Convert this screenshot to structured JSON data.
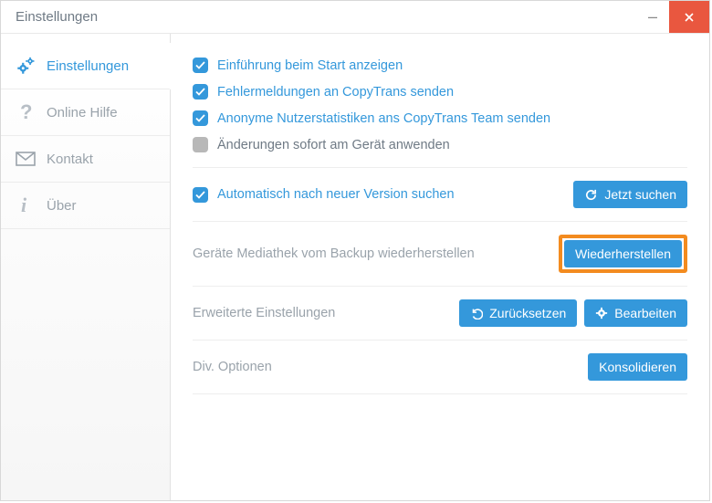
{
  "window": {
    "title": "Einstellungen"
  },
  "sidebar": {
    "items": [
      {
        "label": "Einstellungen"
      },
      {
        "label": "Online Hilfe"
      },
      {
        "label": "Kontakt"
      },
      {
        "label": "Über"
      }
    ]
  },
  "checks": {
    "c0": "Einführung beim Start anzeigen",
    "c1": "Fehlermeldungen an CopyTrans senden",
    "c2": "Anonyme Nutzerstatistiken ans CopyTrans Team senden",
    "c3": "Änderungen sofort am Gerät anwenden"
  },
  "rows": {
    "auto_check_label": "Automatisch nach neuer Version suchen",
    "search_btn": "Jetzt suchen",
    "restore_label": "Geräte Mediathek vom Backup wiederherstellen",
    "restore_btn": "Wiederherstellen",
    "advanced_label": "Erweiterte Einstellungen",
    "reset_btn": "Zurücksetzen",
    "edit_btn": "Bearbeiten",
    "div_label": "Div. Optionen",
    "consolidate_btn": "Konsolidieren"
  }
}
